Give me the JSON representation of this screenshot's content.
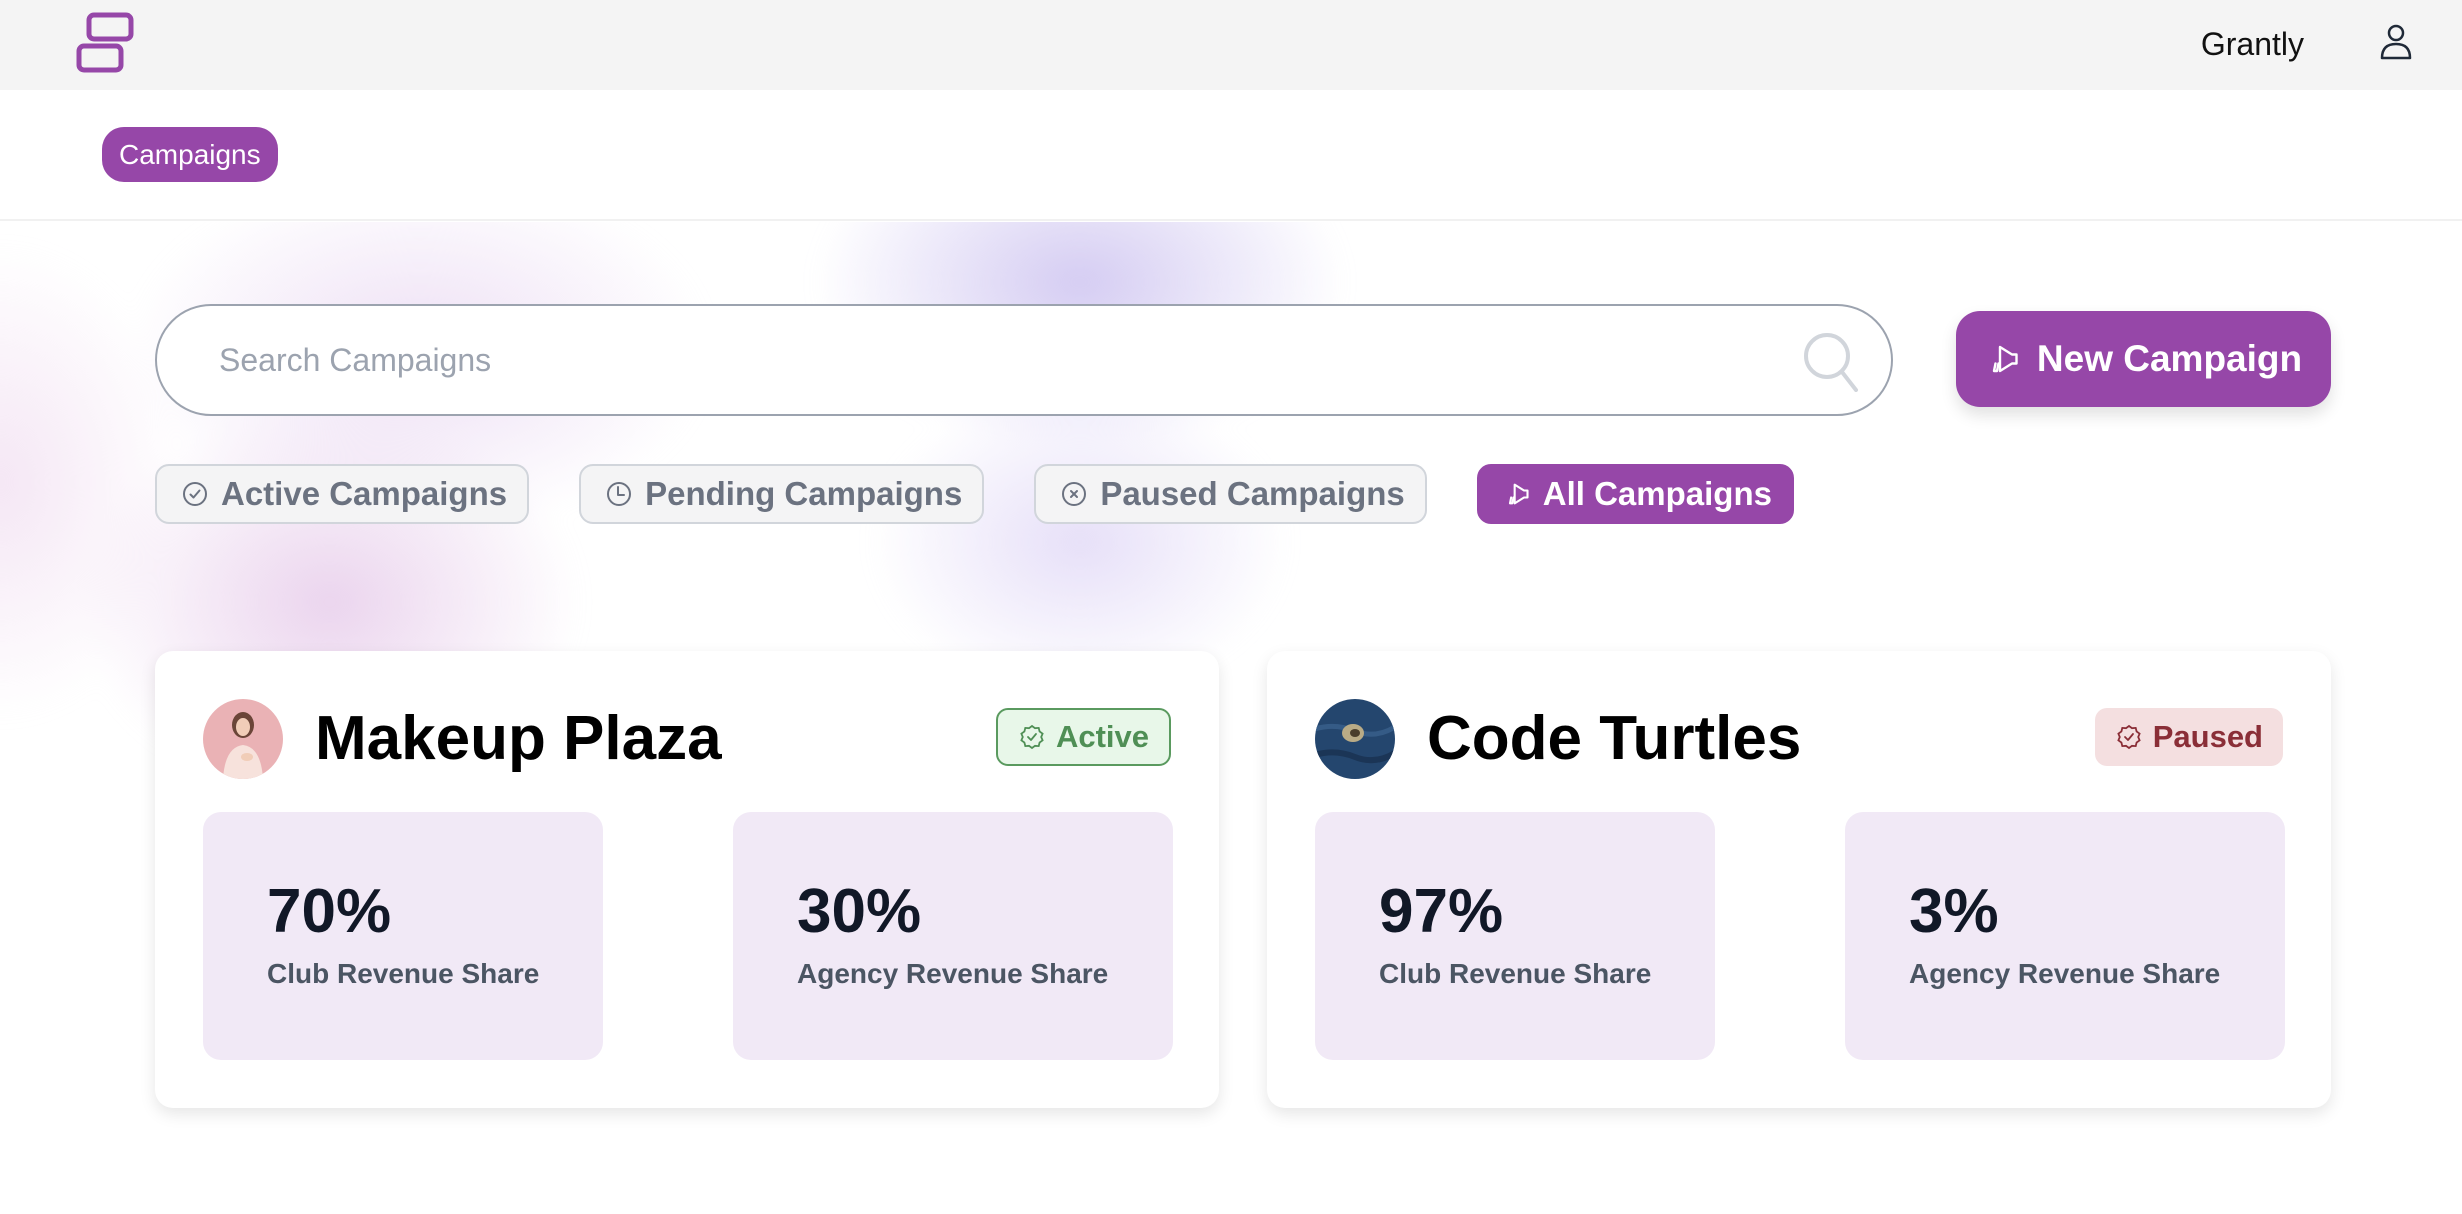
{
  "header": {
    "brand": "Grantly",
    "logo_icon": "stacked-rectangles-logo",
    "user_icon": "user-icon"
  },
  "subnav": {
    "active_tab": "Campaigns"
  },
  "search": {
    "placeholder": "Search Campaigns",
    "value": ""
  },
  "actions": {
    "new_campaign": "New Campaign"
  },
  "filters": [
    {
      "label": "Active Campaigns",
      "icon": "check-circle-icon",
      "selected": false
    },
    {
      "label": "Pending Campaigns",
      "icon": "clock-icon",
      "selected": false
    },
    {
      "label": "Paused Campaigns",
      "icon": "x-circle-icon",
      "selected": false
    },
    {
      "label": "All Campaigns",
      "icon": "megaphone-icon",
      "selected": true
    }
  ],
  "campaigns": [
    {
      "name": "Makeup Plaza",
      "status": "Active",
      "stats": [
        {
          "value": "70%",
          "label": "Club Revenue Share"
        },
        {
          "value": "30%",
          "label": "Agency Revenue Share"
        }
      ]
    },
    {
      "name": "Code Turtles",
      "status": "Paused",
      "stats": [
        {
          "value": "97%",
          "label": "Club Revenue Share"
        },
        {
          "value": "3%",
          "label": "Agency Revenue Share"
        }
      ]
    }
  ],
  "colors": {
    "brand": "#9647a8",
    "active_badge_bg": "#e8f7e9",
    "active_badge_text": "#4f8f55",
    "paused_badge_bg": "#f4dfe0",
    "paused_badge_text": "#8a2e37",
    "stat_bg": "#f1e9f6"
  }
}
